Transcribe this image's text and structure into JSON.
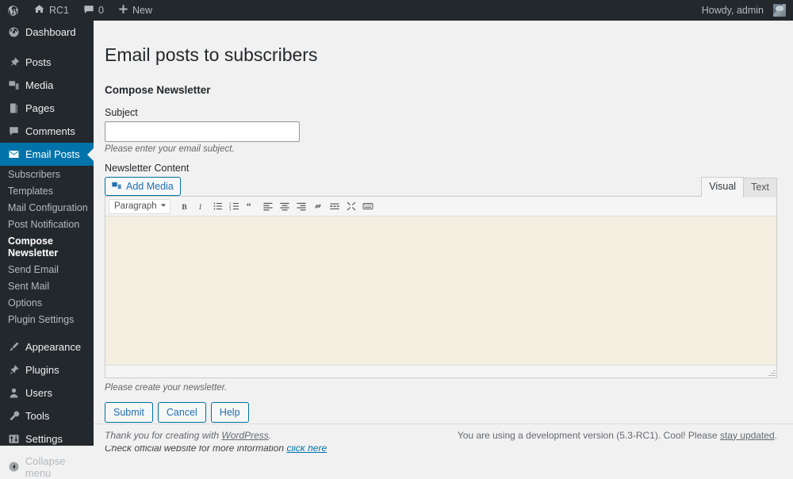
{
  "adminbar": {
    "wp_logo": "wordpress-logo",
    "site_name": "RC1",
    "comments_count": "0",
    "new_label": "New",
    "howdy": "Howdy, admin"
  },
  "sidebar": {
    "items": [
      {
        "label": "Dashboard",
        "icon": "dashboard-icon",
        "name": "dashboard"
      },
      {
        "label": "Posts",
        "icon": "pin-icon",
        "name": "posts"
      },
      {
        "label": "Media",
        "icon": "media-icon",
        "name": "media"
      },
      {
        "label": "Pages",
        "icon": "pages-icon",
        "name": "pages"
      },
      {
        "label": "Comments",
        "icon": "comment-icon",
        "name": "comments"
      },
      {
        "label": "Email Posts",
        "icon": "envelope-icon",
        "name": "email-posts"
      },
      {
        "label": "Appearance",
        "icon": "brush-icon",
        "name": "appearance"
      },
      {
        "label": "Plugins",
        "icon": "plug-icon",
        "name": "plugins"
      },
      {
        "label": "Users",
        "icon": "user-icon",
        "name": "users"
      },
      {
        "label": "Tools",
        "icon": "wrench-icon",
        "name": "tools"
      },
      {
        "label": "Settings",
        "icon": "settings-icon",
        "name": "settings"
      }
    ],
    "submenu": [
      "Subscribers",
      "Templates",
      "Mail Configuration",
      "Post Notification",
      "Compose Newsletter",
      "Send Email",
      "Sent Mail",
      "Options",
      "Plugin Settings"
    ],
    "submenu_current": "Compose Newsletter",
    "collapse_label": "Collapse menu"
  },
  "main": {
    "page_title": "Email posts to subscribers",
    "section_title": "Compose Newsletter",
    "subject": {
      "label": "Subject",
      "value": "",
      "placeholder": "",
      "help": "Please enter your email subject."
    },
    "content": {
      "label": "Newsletter Content",
      "add_media_label": "Add Media",
      "tabs": [
        {
          "label": "Visual",
          "active": true
        },
        {
          "label": "Text",
          "active": false
        }
      ],
      "format_select": "Paragraph",
      "toolbar": [
        "bold-icon",
        "italic-icon",
        "bulleted-list-icon",
        "numbered-list-icon",
        "blockquote-icon",
        "align-left-icon",
        "align-center-icon",
        "align-right-icon",
        "link-icon",
        "read-more-icon",
        "fullscreen-icon",
        "toolbar-toggle-icon"
      ],
      "body_text": "",
      "help": "Please create your newsletter."
    },
    "buttons": [
      {
        "label": "Submit",
        "name": "submit-button"
      },
      {
        "label": "Cancel",
        "name": "cancel-button"
      },
      {
        "label": "Help",
        "name": "help-button"
      }
    ],
    "official_text": "Check official website for more information",
    "official_link": "click here"
  },
  "footer": {
    "left_prefix": "Thank you for creating with ",
    "left_link": "WordPress",
    "left_suffix": ".",
    "right_prefix": "You are using a development version (5.3-RC1). Cool! Please ",
    "right_link": "stay updated",
    "right_suffix": "."
  },
  "colors": {
    "admin_dark": "#23282d",
    "accent_blue": "#0073aa",
    "link_blue": "#2271b1",
    "editor_bg": "#f4eee1",
    "content_bg": "#f1f1f1"
  }
}
